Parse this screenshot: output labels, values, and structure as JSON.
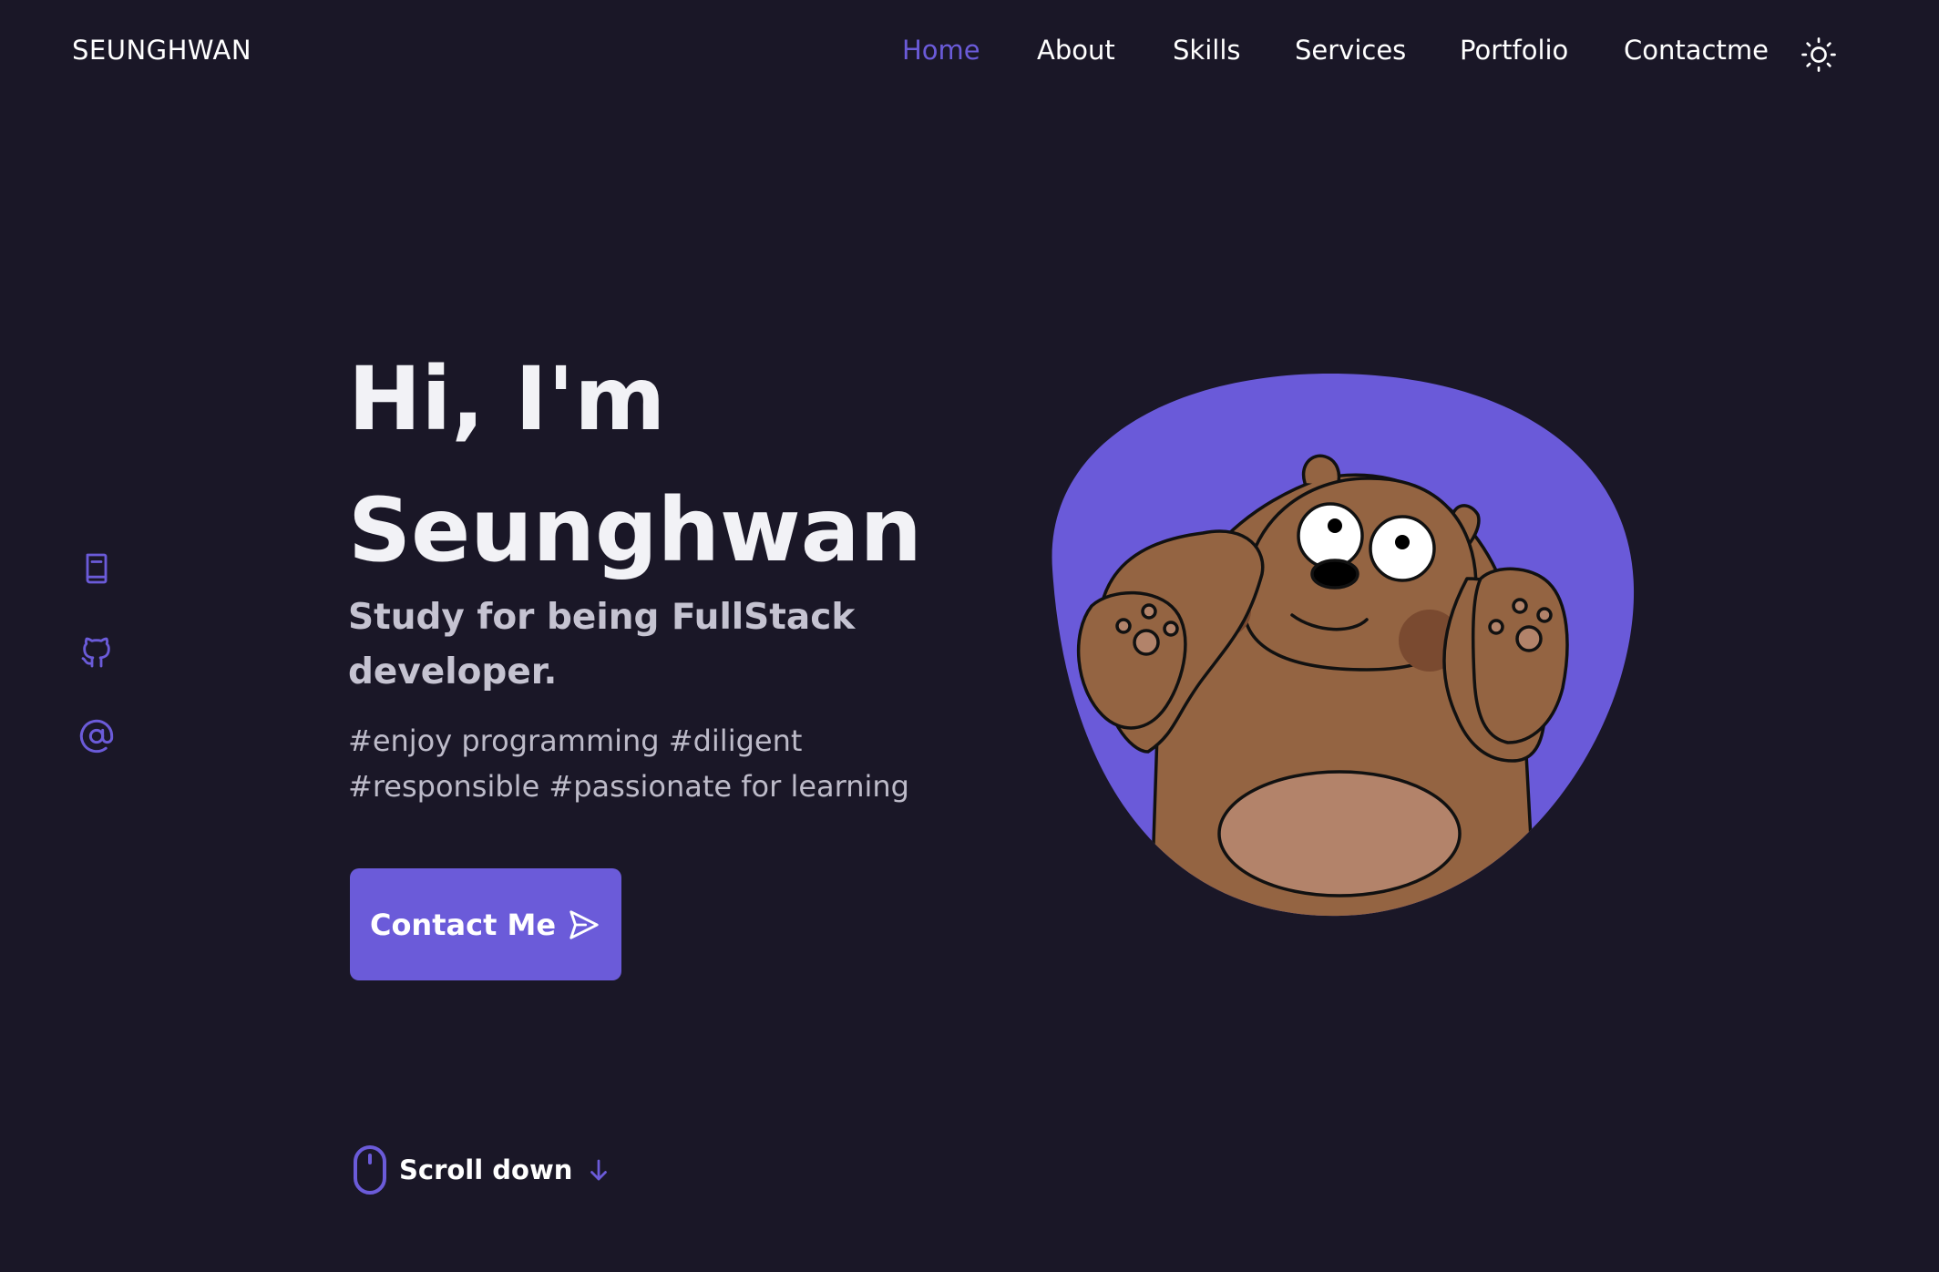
{
  "header": {
    "logo": "SEUNGHWAN",
    "nav": [
      {
        "label": "Home",
        "active": true
      },
      {
        "label": "About",
        "active": false
      },
      {
        "label": "Skills",
        "active": false
      },
      {
        "label": "Services",
        "active": false
      },
      {
        "label": "Portfolio",
        "active": false
      },
      {
        "label": "Contactme",
        "active": false
      }
    ],
    "theme_toggle_icon": "sun-icon"
  },
  "social": [
    {
      "icon": "book-icon"
    },
    {
      "icon": "github-icon"
    },
    {
      "icon": "at-sign-icon"
    }
  ],
  "hero": {
    "title_line1": "Hi, I'm",
    "title_line2": "Seunghwan",
    "subtitle": "Study for being FullStack developer.",
    "tags": "#enjoy programming #diligent #responsible #passionate for learning",
    "contact_button": "Contact Me",
    "contact_button_icon": "send-icon",
    "image_icon": "bear-avatar"
  },
  "scroll": {
    "label": "Scroll down",
    "mouse_icon": "mouse-icon",
    "arrow_icon": "arrow-down-icon"
  },
  "colors": {
    "background": "#1a1727",
    "accent": "#6b5bd9",
    "text": "#ffffff",
    "muted_text": "#c5c3d1"
  }
}
